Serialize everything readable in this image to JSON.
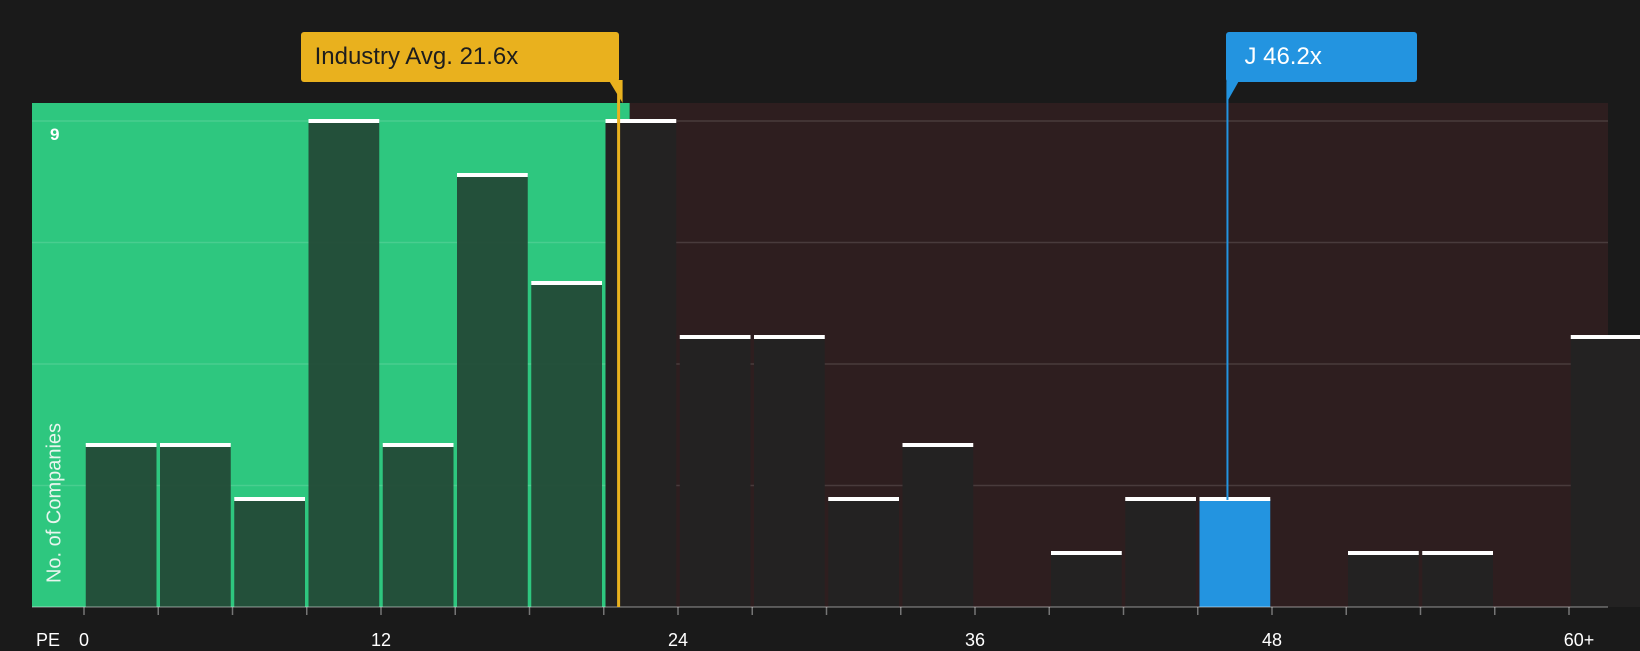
{
  "chart_data": {
    "type": "bar",
    "x_axis_label": "PE",
    "y_axis_label": "No. of Companies",
    "y_max_label": "9",
    "ylim": [
      0,
      9
    ],
    "grid": true,
    "x_ticks": [
      "0",
      "12",
      "24",
      "36",
      "48",
      "60+"
    ],
    "x_tick_values": [
      0,
      12,
      24,
      36,
      48,
      60
    ],
    "bin_width": 3,
    "bins": [
      {
        "start": 0,
        "count": 3
      },
      {
        "start": 3,
        "count": 3
      },
      {
        "start": 6,
        "count": 2
      },
      {
        "start": 9,
        "count": 9
      },
      {
        "start": 12,
        "count": 3
      },
      {
        "start": 15,
        "count": 8
      },
      {
        "start": 18,
        "count": 6
      },
      {
        "start": 21,
        "count": 9
      },
      {
        "start": 24,
        "count": 5
      },
      {
        "start": 27,
        "count": 5
      },
      {
        "start": 30,
        "count": 2
      },
      {
        "start": 33,
        "count": 3
      },
      {
        "start": 36,
        "count": 0
      },
      {
        "start": 39,
        "count": 1
      },
      {
        "start": 42,
        "count": 2
      },
      {
        "start": 45,
        "count": 2
      },
      {
        "start": 48,
        "count": 0
      },
      {
        "start": 51,
        "count": 1
      },
      {
        "start": 54,
        "count": 1
      },
      {
        "start": 57,
        "count": 0
      },
      {
        "start": 60,
        "count": 5
      }
    ],
    "industry_avg": {
      "label": "Industry Avg. 21.6x",
      "value": 21.6
    },
    "subject": {
      "label": "J 46.2x",
      "value": 46.2,
      "bin_start": 45
    },
    "colors": {
      "background": "#1a1a1a",
      "below_avg_region": "#2ec77f",
      "above_avg_region": "#2e1e1f",
      "industry_avg": "#e9b11e",
      "subject": "#2394e0",
      "bar_below": "#234a37",
      "bar_above": "#232222",
      "bar_cap": "#ffffff"
    }
  }
}
